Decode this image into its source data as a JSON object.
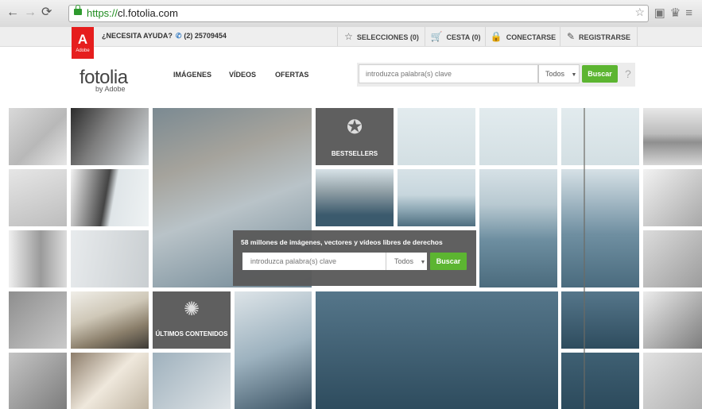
{
  "browser": {
    "url_scheme": "https://",
    "url_host": "cl.fotolia.com",
    "back_icon": "arrow-left-icon",
    "forward_icon": "arrow-right-icon",
    "reload_icon": "reload-icon"
  },
  "topbar": {
    "brand_word": "Adobe",
    "help_text": "¿NECESITA AYUDA?",
    "phone": "(2) 25709454",
    "selections": "SELECCIONES (0)",
    "cart": "CESTA (0)",
    "login": "CONECTARSE",
    "register": "REGISTRARSE"
  },
  "header": {
    "logo": "fotolia",
    "logo_sub": "by Adobe",
    "nav": [
      "IMÁGENES",
      "VÍDEOS",
      "OFERTAS"
    ],
    "search_placeholder": "introduzca palabra(s) clave",
    "filter_value": "Todos",
    "search_button": "Buscar",
    "help_mark": "?"
  },
  "mosaic": {
    "bestsellers": "BESTSELLERS",
    "latest": "ÚLTIMOS CONTENIDOS",
    "latest_badge": "new",
    "overlay_title": "58 millones de imágenes, vectores y vídeos libres de derechos",
    "overlay_placeholder": "introduzca palabra(s) clave",
    "overlay_filter": "Todos",
    "overlay_button": "Buscar"
  },
  "colors": {
    "accent_green": "#5cb531",
    "adobe_red": "#e61e1e"
  }
}
